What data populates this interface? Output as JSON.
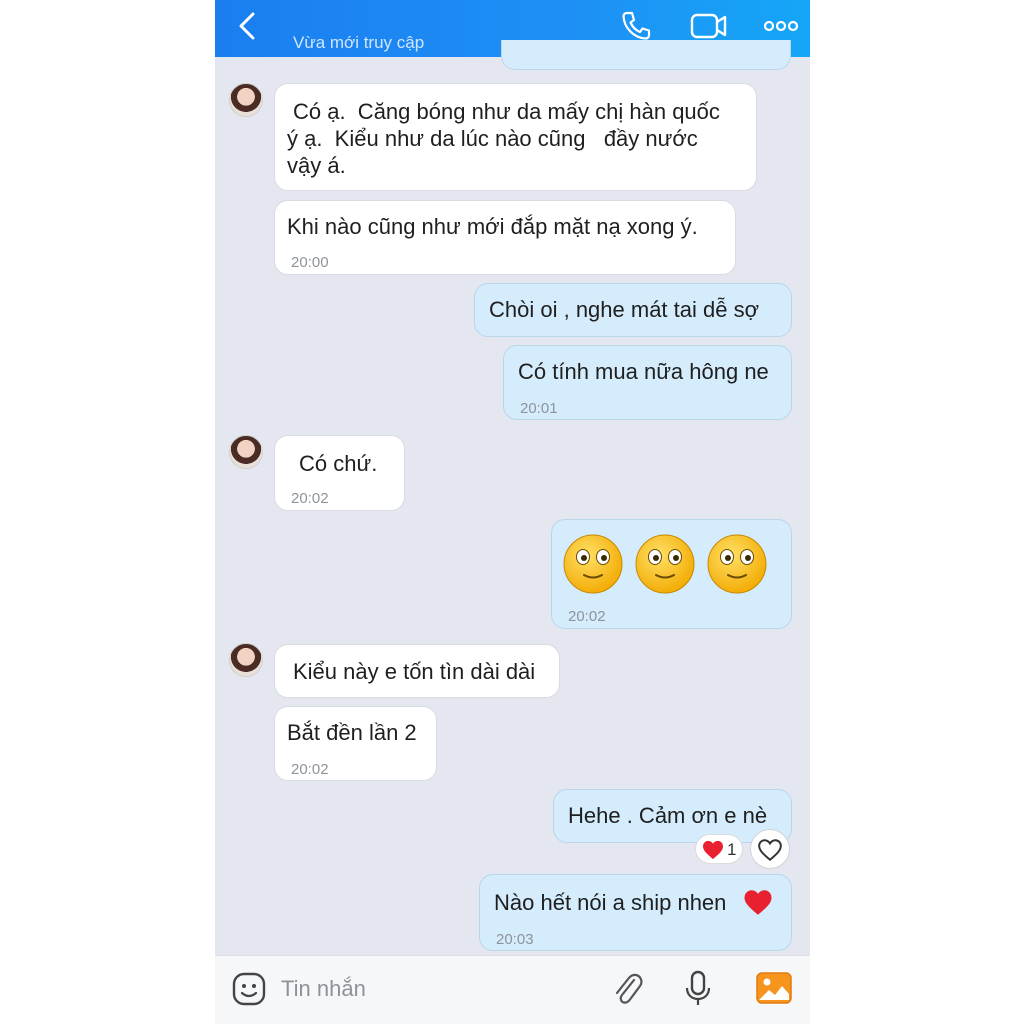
{
  "header": {
    "status": "Vừa mới truy cập",
    "back_icon": "chevron-left-icon",
    "call_icon": "phone-icon",
    "video_icon": "video-camera-icon",
    "more_icon": "more-dots-icon"
  },
  "messages": [
    {
      "from": "them",
      "lines": [
        "Có ạ.  Căng bóng như da mấy chị hàn quốc",
        "ý ạ.  Kiểu như da lúc nào cũng   đầy nước",
        "vậy á."
      ],
      "time": ""
    },
    {
      "from": "them",
      "lines": [
        "Khi nào cũng như mới đắp mặt nạ xong ý."
      ],
      "time": "20:00"
    },
    {
      "from": "me",
      "lines": [
        "Chòi oi , nghe mát tai dễ sợ"
      ],
      "time": ""
    },
    {
      "from": "me",
      "lines": [
        "Có tính mua nữa hông ne"
      ],
      "time": "20:01"
    },
    {
      "from": "them",
      "lines": [
        "Có chứ."
      ],
      "time": "20:02"
    },
    {
      "from": "me",
      "lines": [],
      "emoji": "slightly-smiling-face x3",
      "time": "20:02"
    },
    {
      "from": "them",
      "lines": [
        "Kiểu này e tốn tìn dài dài"
      ],
      "time": ""
    },
    {
      "from": "them",
      "lines": [
        "Bắt đền lần 2"
      ],
      "time": "20:02"
    },
    {
      "from": "me",
      "lines": [
        "Hehe . Cảm ơn e nè"
      ],
      "time": "",
      "reaction": {
        "icon": "red-heart-icon",
        "count": "1"
      }
    },
    {
      "from": "me",
      "lines": [
        "Nào hết nói a ship nhen"
      ],
      "time": "20:03",
      "trailing_icon": "red-heart-icon"
    }
  ],
  "input": {
    "placeholder": "Tin nhắn",
    "sticker_icon": "sticker-face-icon",
    "attach_icon": "paperclip-icon",
    "mic_icon": "microphone-icon",
    "photo_icon": "photo-gallery-icon"
  },
  "colors": {
    "header": "#1e88f2",
    "chat_bg": "#e4e7ef",
    "sent_bubble": "#d4ecfc",
    "recv_bubble": "#ffffff",
    "heart": "#e8202f"
  }
}
